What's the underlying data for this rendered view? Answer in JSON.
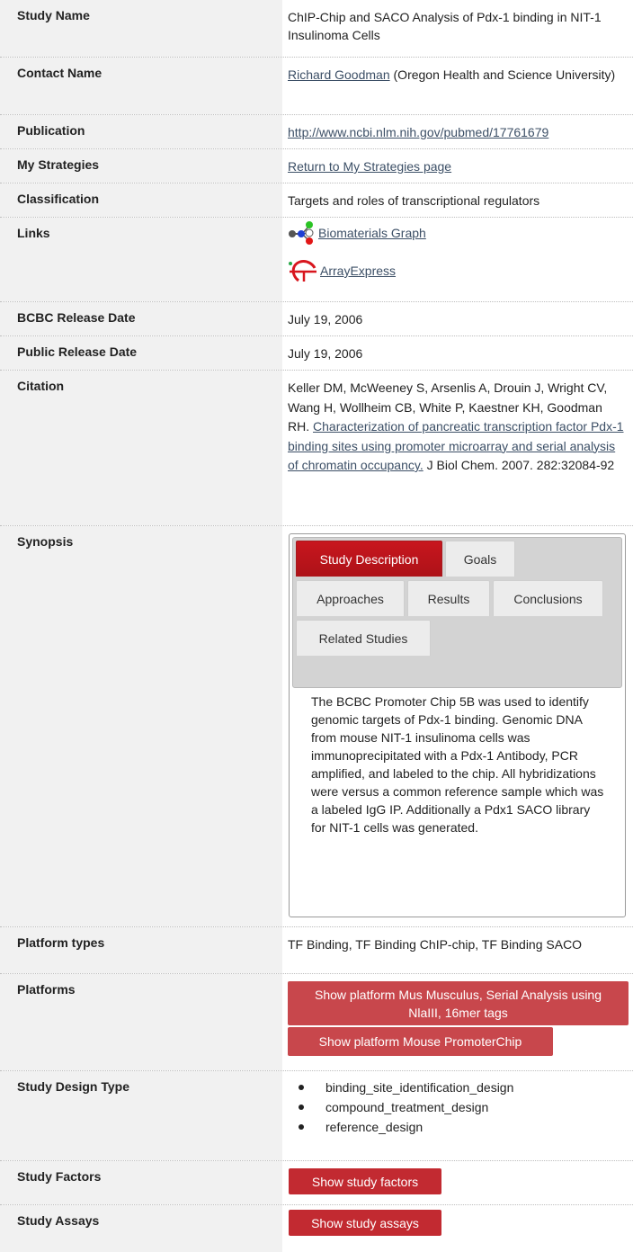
{
  "rows": {
    "study_name": {
      "label": "Study Name",
      "value": "ChIP-Chip and SACO Analysis of Pdx-1 binding in NIT-1 Insulinoma Cells"
    },
    "contact_name": {
      "label": "Contact Name",
      "link": "Richard Goodman",
      "suffix": "(Oregon Health and Science University)"
    },
    "publication": {
      "label": "Publication",
      "link": "http://www.ncbi.nlm.nih.gov/pubmed/17761679"
    },
    "my_strategies": {
      "label": "My Strategies",
      "link": "Return to My Strategies page"
    },
    "classification": {
      "label": "Classification",
      "value": "Targets and roles of transcriptional regulators"
    },
    "links": {
      "label": "Links",
      "items": [
        {
          "text": "Biomaterials Graph",
          "icon": "biomaterials-graph-icon"
        },
        {
          "text": "ArrayExpress",
          "icon": "arrayexpress-logo-icon"
        }
      ]
    },
    "bcbc_release": {
      "label": "BCBC Release Date",
      "value": "July 19, 2006"
    },
    "public_release": {
      "label": "Public Release Date",
      "value": "July 19, 2006"
    },
    "citation": {
      "label": "Citation",
      "authors": "Keller DM, McWeeney S, Arsenlis A, Drouin J, Wright CV, Wang H, Wollheim CB, White P, Kaestner KH, Goodman RH.",
      "title_link": "Characterization of pancreatic transcription factor Pdx-1 binding sites using promoter microarray and serial analysis of chromatin occupancy.",
      "journal": "J Biol Chem. 2007. 282:32084-92"
    },
    "synopsis": {
      "label": "Synopsis",
      "tabs": [
        "Study Description",
        "Goals",
        "Approaches",
        "Results",
        "Conclusions",
        "Related Studies"
      ],
      "active_tab": "Study Description",
      "body": "The BCBC Promoter Chip 5B was used to identify genomic targets of Pdx-1 binding. Genomic DNA from mouse NIT-1 insulinoma cells was immunoprecipitated with a Pdx-1 Antibody, PCR amplified, and labeled to the chip. All hybridizations were versus a common reference sample which was a labeled IgG IP. Additionally a Pdx1 SACO library for NIT-1 cells was generated."
    },
    "platform_types": {
      "label": "Platform types",
      "value": "TF Binding, TF Binding ChIP-chip, TF Binding SACO"
    },
    "platforms": {
      "label": "Platforms",
      "buttons": [
        "Show platform Mus Musculus, Serial Analysis using NlaIII, 16mer tags",
        "Show platform Mouse PromoterChip"
      ]
    },
    "study_design_type": {
      "label": "Study Design Type",
      "items": [
        "binding_site_identification_design",
        "compound_treatment_design",
        "reference_design"
      ]
    },
    "study_factors": {
      "label": "Study Factors",
      "button": "Show study factors"
    },
    "study_assays": {
      "label": "Study Assays",
      "button": "Show study assays"
    }
  },
  "colors": {
    "accent": "#c8161e",
    "button": "#c8474c",
    "link": "#3c4f66",
    "label_bg": "#f1f1f1"
  }
}
